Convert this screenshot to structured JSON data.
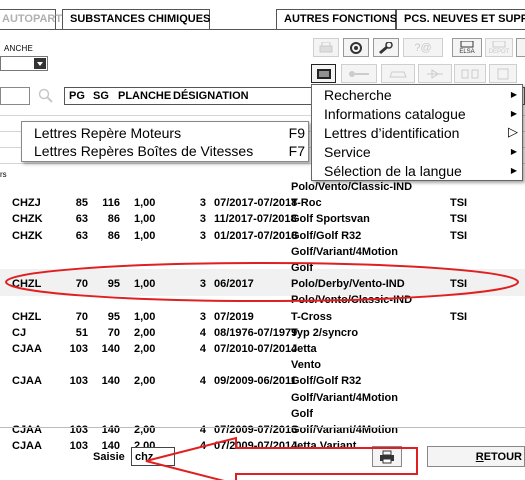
{
  "tabs": {
    "autopart": "AUTOPART",
    "substances": "SUBSTANCES CHIMIQUES",
    "autres": "AUTRES FONCTIONS ▶",
    "pcs": "PCS. NEUVES ET SUPPR"
  },
  "toolbar": {
    "planche_label": "ANCHE",
    "elsa_label": "ELSA",
    "depot_label": "DEPOT"
  },
  "list_header": {
    "pg": "PG",
    "sg": "SG",
    "planche": "PLANCHE",
    "designation": "DÉSIGNATION"
  },
  "popup": {
    "items": [
      {
        "label": "Lettres Repère Moteurs",
        "key": "F9"
      },
      {
        "label": "Lettres Repères Boîtes de Vitesses",
        "key": "F7"
      }
    ]
  },
  "context_menu": {
    "items": [
      {
        "label": "Recherche"
      },
      {
        "label": "Informations catalogue"
      },
      {
        "label": "Lettres d’identification"
      },
      {
        "label": "Service"
      },
      {
        "label": "Sélection de la langue"
      }
    ]
  },
  "side_fragment": "rs",
  "table": {
    "rows": [
      {
        "code": "",
        "kw": "",
        "ch": "",
        "cyl": "",
        "n": "",
        "dates": "",
        "model": "Polo/Vento/Classic-IND",
        "fuel": ""
      },
      {
        "code": "CHZJ",
        "kw": "85",
        "ch": "116",
        "cyl": "1,00",
        "n": "3",
        "dates": "07/2017-07/2018",
        "model": "T-Roc",
        "fuel": "TSI"
      },
      {
        "code": "CHZK",
        "kw": "63",
        "ch": "86",
        "cyl": "1,00",
        "n": "3",
        "dates": "11/2017-07/2018",
        "model": "Golf Sportsvan",
        "fuel": "TSI"
      },
      {
        "code": "CHZK",
        "kw": "63",
        "ch": "86",
        "cyl": "1,00",
        "n": "3",
        "dates": "01/2017-07/2018",
        "model": "Golf/Golf R32",
        "fuel": "TSI"
      },
      {
        "code": "",
        "kw": "",
        "ch": "",
        "cyl": "",
        "n": "",
        "dates": "",
        "model": "Golf/Variant/4Motion",
        "fuel": ""
      },
      {
        "code": "",
        "kw": "",
        "ch": "",
        "cyl": "",
        "n": "",
        "dates": "",
        "model": "Golf",
        "fuel": ""
      },
      {
        "code": "CHZL",
        "kw": "70",
        "ch": "95",
        "cyl": "1,00",
        "n": "3",
        "dates": "06/2017",
        "model": "Polo/Derby/Vento-IND",
        "fuel": "TSI"
      },
      {
        "code": "",
        "kw": "",
        "ch": "",
        "cyl": "",
        "n": "",
        "dates": "",
        "model": "Polo/Vento/Classic-IND",
        "fuel": ""
      },
      {
        "code": "CHZL",
        "kw": "70",
        "ch": "95",
        "cyl": "1,00",
        "n": "3",
        "dates": "07/2019",
        "model": "T-Cross",
        "fuel": "TSI"
      },
      {
        "code": "CJ",
        "kw": "51",
        "ch": "70",
        "cyl": "2,00",
        "n": "4",
        "dates": "08/1976-07/1979",
        "model": "Typ 2/syncro",
        "fuel": ""
      },
      {
        "code": "CJAA",
        "kw": "103",
        "ch": "140",
        "cyl": "2,00",
        "n": "4",
        "dates": "07/2010-07/2014",
        "model": "Jetta",
        "fuel": ""
      },
      {
        "code": "",
        "kw": "",
        "ch": "",
        "cyl": "",
        "n": "",
        "dates": "",
        "model": "Vento",
        "fuel": ""
      },
      {
        "code": "CJAA",
        "kw": "103",
        "ch": "140",
        "cyl": "2,00",
        "n": "4",
        "dates": "09/2009-06/2011",
        "model": "Golf/Golf R32",
        "fuel": ""
      },
      {
        "code": "",
        "kw": "",
        "ch": "",
        "cyl": "",
        "n": "",
        "dates": "",
        "model": "Golf/Variant/4Motion",
        "fuel": ""
      },
      {
        "code": "",
        "kw": "",
        "ch": "",
        "cyl": "",
        "n": "",
        "dates": "",
        "model": "Golf",
        "fuel": ""
      },
      {
        "code": "CJAA",
        "kw": "103",
        "ch": "140",
        "cyl": "2,00",
        "n": "4",
        "dates": "07/2009-07/2013",
        "model": "Golf/Variant/4Motion",
        "fuel": ""
      },
      {
        "code": "CJAA",
        "kw": "103",
        "ch": "140",
        "cyl": "2,00",
        "n": "4",
        "dates": "07/2009-07/2014",
        "model": "Jetta Variant",
        "fuel": ""
      }
    ]
  },
  "bottom": {
    "saisie_label": "Saisie",
    "saisie_value": "chz",
    "retour_label": "RETOUR",
    "retour_underline": "R",
    "retour_rest": "ETOUR"
  },
  "annotation_color": "#e02020"
}
